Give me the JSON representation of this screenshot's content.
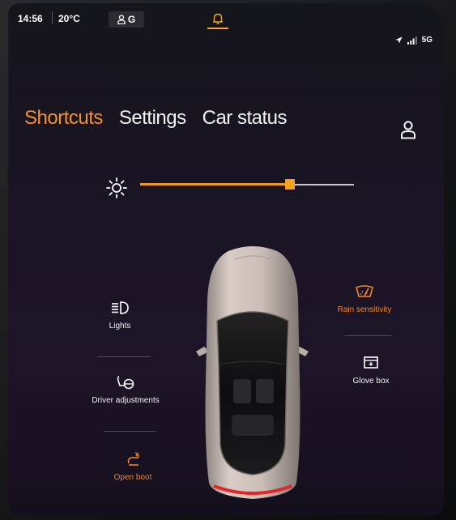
{
  "status_bar": {
    "time": "14:56",
    "temperature": "20°C",
    "profile_letter": "G",
    "network": "5G"
  },
  "tabs": [
    {
      "label": "Shortcuts",
      "active": true
    },
    {
      "label": "Settings",
      "active": false
    },
    {
      "label": "Car status",
      "active": false
    }
  ],
  "brightness": {
    "level": 0.7
  },
  "shortcuts_left": [
    {
      "label": "Lights",
      "icon": "headlight-icon"
    },
    {
      "label": "Driver adjustments",
      "icon": "seat-steering-icon"
    },
    {
      "label": "Open boot",
      "icon": "boot-icon"
    }
  ],
  "shortcuts_right": [
    {
      "label": "Rain sensitivity",
      "icon": "wiper-icon"
    },
    {
      "label": "Glove box",
      "icon": "glove-box-icon"
    }
  ],
  "colors": {
    "accent": "#f5902a",
    "text": "#f2f2f2",
    "background": "#17141f"
  }
}
